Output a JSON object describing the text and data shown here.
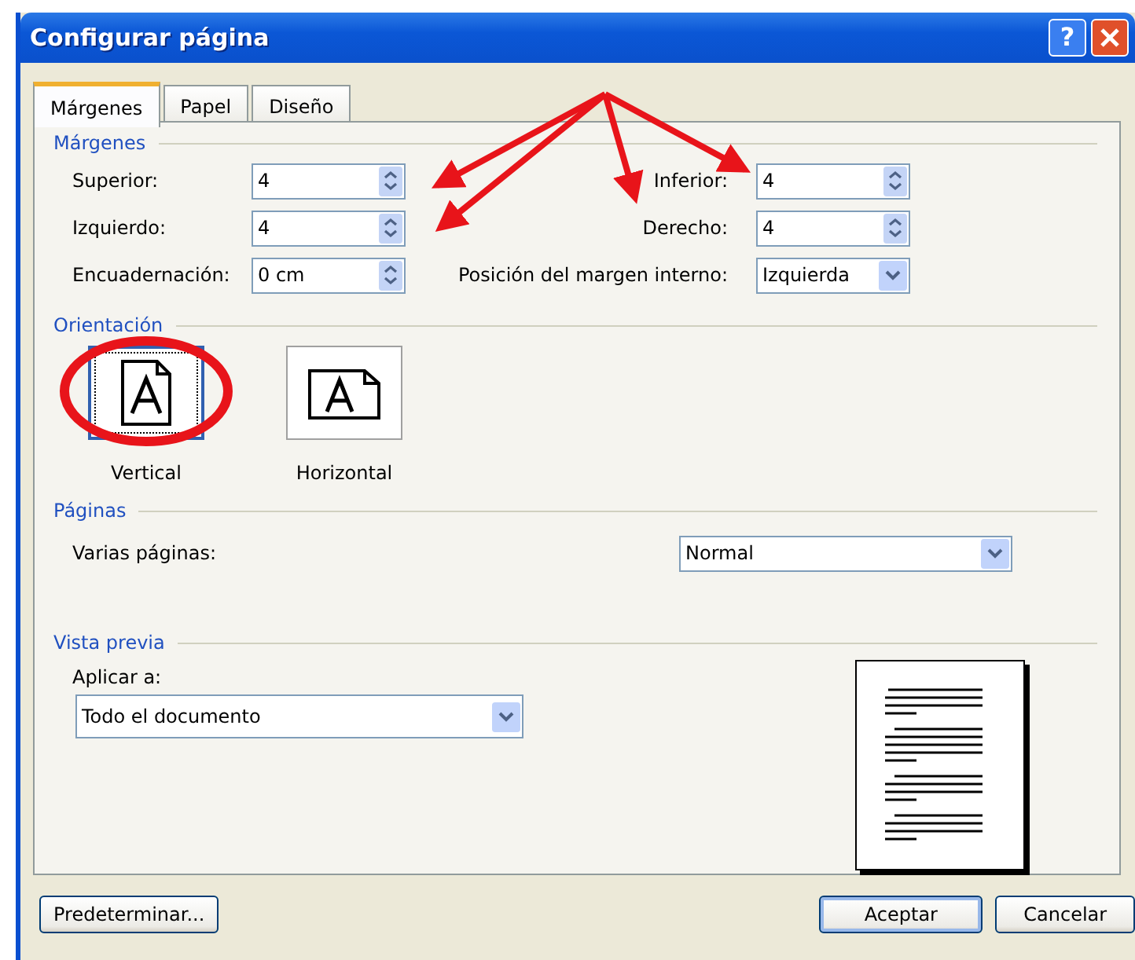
{
  "window": {
    "title": "Configurar página",
    "title_buttons": [
      {
        "kind": "help",
        "label": "?"
      },
      {
        "kind": "close"
      }
    ]
  },
  "tabs": [
    {
      "label": "Márgenes",
      "selected": true
    },
    {
      "label": "Papel",
      "selected": false
    },
    {
      "label": "Diseño",
      "selected": false
    }
  ],
  "margins": {
    "legend": "Márgenes",
    "left_fields": [
      {
        "label": "Superior:",
        "value": "4",
        "kind": "spin"
      },
      {
        "label": "Izquierdo:",
        "value": "4",
        "kind": "spin"
      },
      {
        "label": "Encuadernación:",
        "value": "0 cm",
        "kind": "spin"
      }
    ],
    "right_fields": [
      {
        "label": "Inferior:",
        "value": "4",
        "kind": "spin"
      },
      {
        "label": "Derecho:",
        "value": "4",
        "kind": "spin"
      },
      {
        "label": "Posición del margen interno:",
        "value": "Izquierda",
        "kind": "dropdown"
      }
    ]
  },
  "orientation": {
    "legend": "Orientación",
    "options": [
      {
        "label": "Vertical",
        "kind": "portrait",
        "selected": true
      },
      {
        "label": "Horizontal",
        "kind": "landscape",
        "selected": false
      }
    ]
  },
  "pages": {
    "legend": "Páginas",
    "label": "Varias páginas:",
    "value": "Normal"
  },
  "preview": {
    "legend": "Vista previa",
    "apply_label": "Aplicar a:",
    "apply_value": "Todo el documento"
  },
  "buttons": [
    {
      "label": "Predeterminar...",
      "kind": "secondary"
    },
    {
      "label": "Aceptar",
      "kind": "default"
    },
    {
      "label": "Cancelar",
      "kind": "secondary"
    }
  ]
}
